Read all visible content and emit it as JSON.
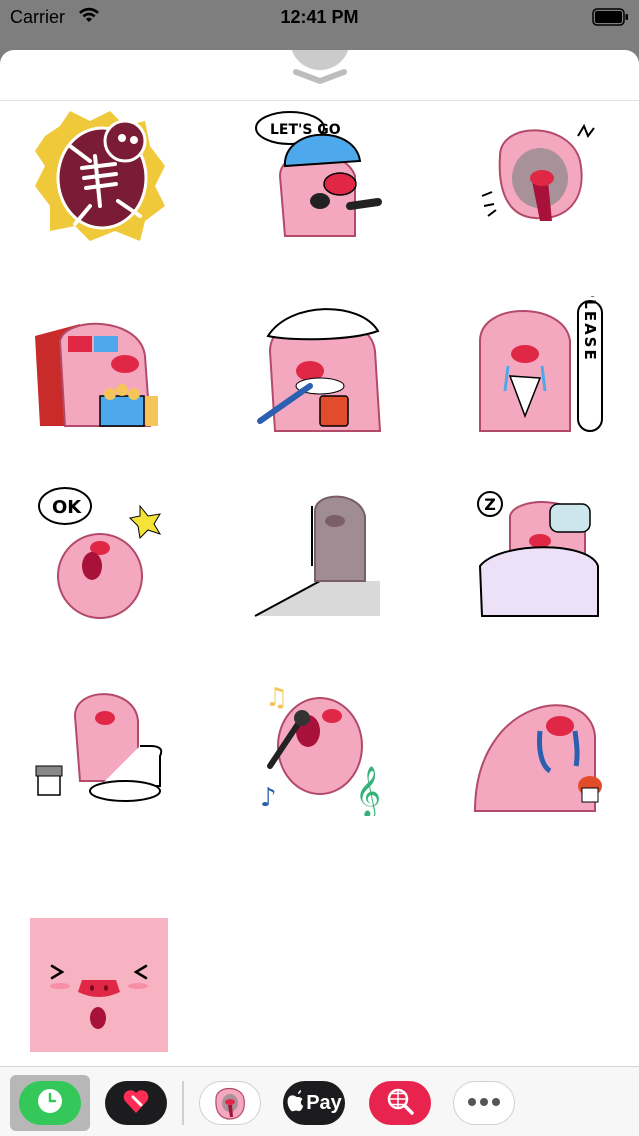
{
  "status_bar": {
    "carrier": "Carrier",
    "time": "12:41 PM",
    "icons": [
      "wifi-icon",
      "battery-icon"
    ]
  },
  "sheet": {
    "grabber_icon": "chevron-down-icon"
  },
  "stickers": [
    {
      "name": "pig-xray-skeleton",
      "text": ""
    },
    {
      "name": "pig-helmet-lets-go",
      "text": "LET'S GO"
    },
    {
      "name": "pig-screaming",
      "text": ""
    },
    {
      "name": "pig-3d-glasses-popcorn",
      "text": ""
    },
    {
      "name": "pig-brushing-teeth",
      "text": ""
    },
    {
      "name": "pig-please-crying",
      "text": "PLEASE"
    },
    {
      "name": "pig-ok-highfive",
      "text": "OK"
    },
    {
      "name": "pig-gray-shadow",
      "text": ""
    },
    {
      "name": "pig-sleeping",
      "text": "Z"
    },
    {
      "name": "pig-toilet",
      "text": ""
    },
    {
      "name": "pig-singing",
      "text": ""
    },
    {
      "name": "pig-crying-cupcake",
      "text": ""
    },
    {
      "name": "pig-face-pink-square",
      "text": ""
    }
  ],
  "app_bar": {
    "apps": [
      {
        "name": "recents",
        "icon": "clock-icon",
        "color": "#34c759"
      },
      {
        "name": "digital-touch",
        "icon": "heart-hand-icon",
        "color": "#1c1c1e"
      },
      {
        "name": "pig-stickers",
        "icon": "pig-sticker-icon",
        "color": "#ffffff"
      },
      {
        "name": "apple-pay",
        "icon": "apple-icon",
        "label": "Pay",
        "color": "#1c1c1e"
      },
      {
        "name": "image-search",
        "icon": "globe-search-icon",
        "color": "#e8244e"
      },
      {
        "name": "more",
        "icon": "ellipsis-icon",
        "color": "#ffffff"
      }
    ]
  },
  "colors": {
    "pig_pink": "#f4a8bf",
    "pig_outline": "#b34a6a",
    "snout": "#e02846",
    "background_dim": "#7e7e7e"
  }
}
